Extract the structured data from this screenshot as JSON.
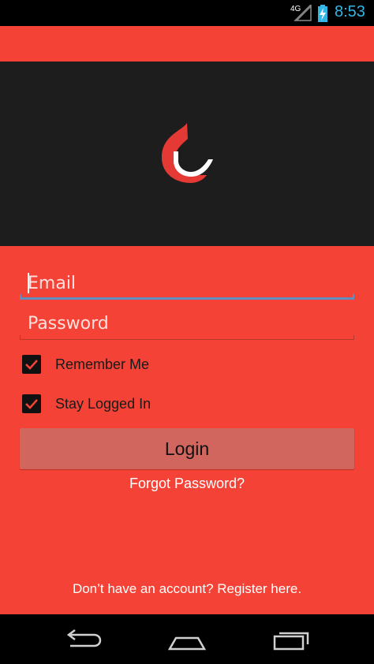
{
  "status_bar": {
    "network": "4G",
    "time": "8:53"
  },
  "login_form": {
    "email_placeholder": "Email",
    "password_placeholder": "Password",
    "remember_me_label": "Remember Me",
    "remember_me_checked": true,
    "stay_logged_in_label": "Stay Logged In",
    "stay_logged_in_checked": true,
    "login_label": "Login",
    "forgot_password_label": "Forgot Password?",
    "register_label": "Don’t have an account? Register here."
  },
  "colors": {
    "accent": "#f44336",
    "header_background": "#1d1d1d",
    "login_button": "#d1665f",
    "status_time": "#33b5e5"
  },
  "icons": {
    "logo": "red-white-hook-logo",
    "checkbox": "check-icon",
    "nav_back": "back-arrow-icon",
    "nav_home": "home-icon",
    "nav_recents": "recent-apps-icon"
  }
}
